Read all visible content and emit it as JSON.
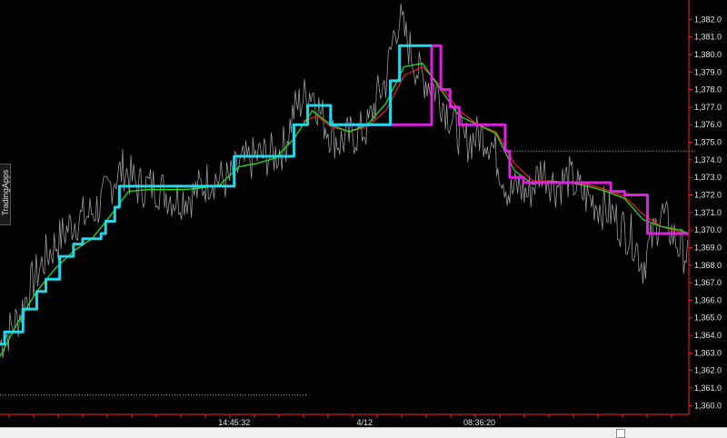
{
  "side_tab": {
    "label": "TradingApps"
  },
  "chart_data": {
    "type": "line",
    "ylim": [
      1359.5,
      1383.0
    ],
    "yticks": [
      1360,
      1361,
      1362,
      1363,
      1364,
      1365,
      1366,
      1367,
      1368,
      1369,
      1370,
      1371,
      1372,
      1373,
      1374,
      1375,
      1376,
      1377,
      1378,
      1379,
      1380,
      1381,
      1382
    ],
    "ytick_labels": [
      "1,360.0",
      "1,361.0",
      "1,362.0",
      "1,363.0",
      "1,364.0",
      "1,365.0",
      "1,366.0",
      "1,367.0",
      "1,368.0",
      "1,369.0",
      "1,370.0",
      "1,371.0",
      "1,372.0",
      "1,373.0",
      "1,374.0",
      "1,375.0",
      "1,376.0",
      "1,377.0",
      "1,378.0",
      "1,379.0",
      "1,380.0",
      "1,381.0",
      "1,382.0"
    ],
    "xlim": [
      0,
      750
    ],
    "xtick_labels": [
      {
        "index": 255,
        "label": "14:45:32"
      },
      {
        "index": 397,
        "label": "4/12"
      },
      {
        "index": 522,
        "label": "08:36:20"
      }
    ],
    "grid": false,
    "reference_lines": [
      {
        "y": 1374.5,
        "x_start": 545,
        "x_end": 758,
        "color": "#c0c0c0"
      },
      {
        "y": 1360.6,
        "x_start": 0,
        "x_end": 335,
        "color": "#c0c0c0"
      }
    ],
    "series": [
      {
        "role": "price",
        "color": "#9a9a9a",
        "x": [
          0,
          20,
          35,
          50,
          65,
          80,
          95,
          110,
          125,
          135,
          150,
          170,
          190,
          210,
          230,
          250,
          260,
          280,
          300,
          310,
          320,
          330,
          340,
          350,
          360,
          370,
          380,
          390,
          400,
          410,
          420,
          430,
          435,
          445,
          455,
          465,
          475,
          485,
          495,
          505,
          515,
          525,
          535,
          545,
          555,
          565,
          575,
          590,
          605,
          620,
          635,
          650,
          665,
          680,
          690,
          700,
          710,
          720,
          730,
          740,
          750
        ],
        "y": [
          1363.5,
          1365.0,
          1367.0,
          1368.5,
          1369.5,
          1370.5,
          1370.8,
          1371.5,
          1373.0,
          1373.5,
          1372.5,
          1372.5,
          1371.8,
          1372.0,
          1373.0,
          1372.8,
          1373.6,
          1374.2,
          1374.3,
          1374.8,
          1376.8,
          1377.5,
          1378.0,
          1376.5,
          1375.5,
          1375.0,
          1375.3,
          1375.5,
          1375.8,
          1377.5,
          1378.5,
          1381.5,
          1382.0,
          1380.5,
          1379.0,
          1378.5,
          1378.0,
          1377.0,
          1376.0,
          1375.0,
          1375.2,
          1375.5,
          1375.0,
          1373.5,
          1372.0,
          1372.5,
          1372.0,
          1373.5,
          1372.5,
          1373.0,
          1372.0,
          1371.5,
          1371.0,
          1370.0,
          1369.5,
          1368.0,
          1369.5,
          1371.0,
          1370.0,
          1369.0,
          1368.5
        ]
      },
      {
        "role": "step-up",
        "color": "#22d8e8",
        "x": [
          0,
          5,
          18,
          25,
          40,
          50,
          65,
          80,
          90,
          100,
          110,
          115,
          125,
          130,
          145,
          170,
          200,
          230,
          250,
          255,
          270,
          300,
          315,
          320,
          335,
          345,
          360,
          380,
          400,
          415,
          425,
          435,
          445,
          470
        ],
        "y": [
          1363.5,
          1364.2,
          1364.2,
          1365.5,
          1366.5,
          1367.2,
          1368.5,
          1369.2,
          1369.5,
          1369.5,
          1369.8,
          1370.5,
          1371.3,
          1372.5,
          1372.5,
          1372.5,
          1372.5,
          1372.5,
          1372.5,
          1374.2,
          1374.2,
          1374.2,
          1374.2,
          1376.0,
          1377.1,
          1377.1,
          1376.0,
          1376.0,
          1376.0,
          1376.0,
          1378.5,
          1380.5,
          1380.5,
          1380.5
        ]
      },
      {
        "role": "step-down",
        "color": "#e020e0",
        "x": [
          345,
          360,
          380,
          400,
          415,
          470,
          480,
          490,
          500,
          510,
          540,
          550,
          555,
          570,
          600,
          650,
          665,
          680,
          700,
          705,
          720,
          750
        ],
        "y": [
          1377.1,
          1376.0,
          1376.0,
          1376.0,
          1376.0,
          1380.5,
          1378.0,
          1377.0,
          1376.0,
          1376.0,
          1376.0,
          1374.5,
          1373.0,
          1372.7,
          1372.7,
          1372.7,
          1372.2,
          1372.0,
          1372.0,
          1369.8,
          1369.8,
          1369.8
        ]
      },
      {
        "role": "moving-average-fast",
        "color": "#22dd22",
        "x": [
          0,
          20,
          40,
          60,
          80,
          100,
          120,
          140,
          160,
          180,
          200,
          220,
          240,
          260,
          280,
          300,
          320,
          340,
          360,
          380,
          400,
          420,
          440,
          460,
          480,
          500,
          520,
          540,
          560,
          580,
          600,
          620,
          640,
          660,
          680,
          700,
          720,
          740,
          750
        ],
        "y": [
          1362.8,
          1364.8,
          1366.5,
          1367.8,
          1368.8,
          1369.5,
          1370.8,
          1372.2,
          1372.3,
          1372.3,
          1372.3,
          1372.4,
          1372.6,
          1373.6,
          1373.8,
          1374.1,
          1375.2,
          1376.8,
          1376.0,
          1375.6,
          1376.0,
          1377.2,
          1379.3,
          1379.5,
          1378.0,
          1376.5,
          1376.0,
          1375.5,
          1373.4,
          1372.6,
          1372.8,
          1372.7,
          1372.5,
          1372.2,
          1371.8,
          1370.6,
          1370.2,
          1370.0,
          1369.8
        ]
      },
      {
        "role": "moving-average-slow",
        "color": "#e02020",
        "x": [
          330,
          345,
          360,
          380,
          400,
          420,
          440,
          460,
          480,
          500,
          520,
          540,
          560,
          580,
          600,
          620,
          640,
          660,
          680,
          700,
          720,
          740,
          750
        ],
        "y": [
          1376.2,
          1376.5,
          1375.9,
          1375.6,
          1375.9,
          1376.8,
          1378.8,
          1379.3,
          1378.2,
          1376.8,
          1376.0,
          1375.6,
          1373.8,
          1372.8,
          1372.8,
          1372.7,
          1372.6,
          1372.3,
          1371.9,
          1370.9,
          1370.2,
          1369.9,
          1369.7
        ]
      }
    ]
  }
}
